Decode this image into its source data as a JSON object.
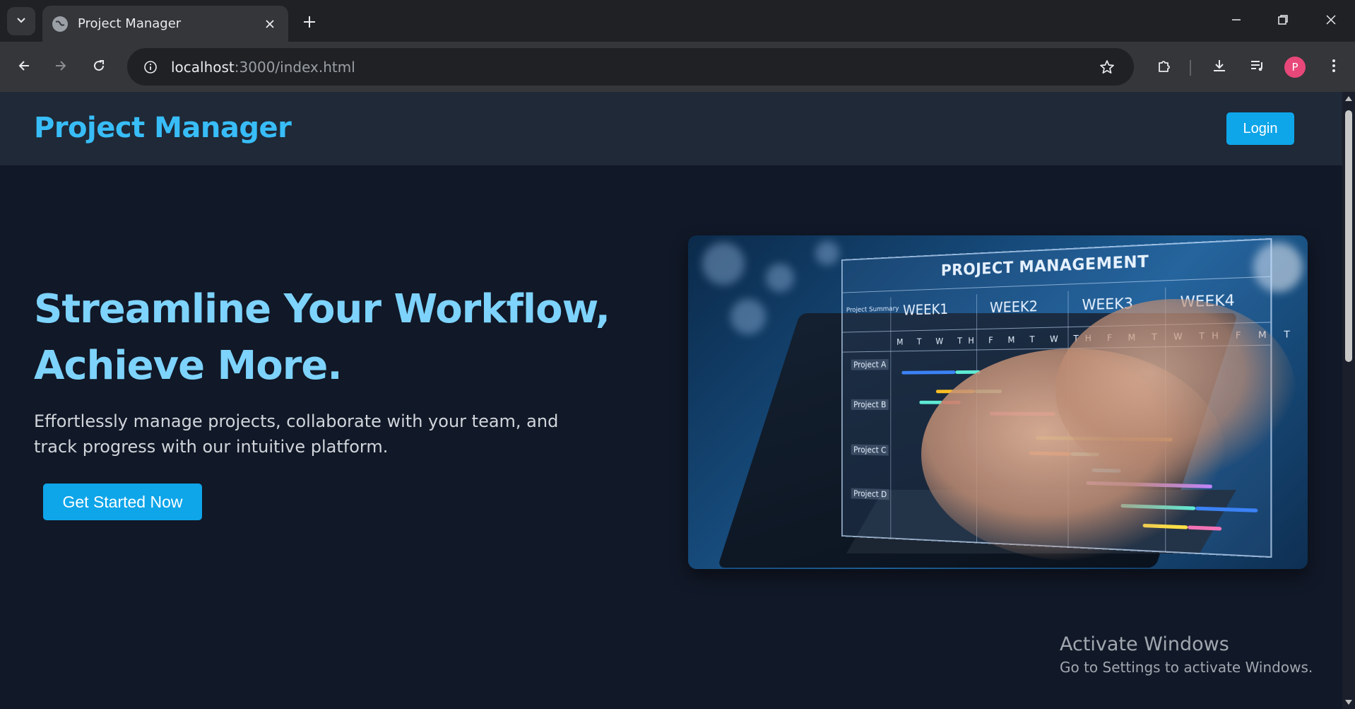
{
  "browser": {
    "tab_title": "Project Manager",
    "url_host": "localhost",
    "url_path": ":3000/index.html",
    "profile_initial": "P"
  },
  "site": {
    "brand": "Project Manager",
    "login_label": "Login"
  },
  "hero": {
    "title_line1": "Streamline Your Workflow,",
    "title_line2": "Achieve More.",
    "subtitle": "Effortlessly manage projects, collaborate with your team, and track progress with our intuitive platform.",
    "cta_label": "Get Started Now"
  },
  "hero_image": {
    "panel_title": "PROJECT MANAGEMENT",
    "summary_label": "Project Summary",
    "weeks": [
      "WEEK1",
      "WEEK2",
      "WEEK3",
      "WEEK4"
    ],
    "days": "M T W TH F M T W TH F M T W TH F M T W TH F",
    "projects": [
      "Project A",
      "Project B",
      "Project C",
      "Project D"
    ]
  },
  "watermark": {
    "title": "Activate Windows",
    "subtitle": "Go to Settings to activate Windows."
  },
  "colors": {
    "page_bg": "#111827",
    "header_bg": "#1f2937",
    "brand": "#38bdf8",
    "hero_title": "#7dd3fc",
    "button": "#0ea5e9"
  },
  "icons": [
    "tab-search-icon",
    "globe-icon",
    "close-icon",
    "plus-icon",
    "minimize-icon",
    "restore-icon",
    "back-arrow-icon",
    "forward-arrow-icon",
    "reload-icon",
    "site-info-icon",
    "star-icon",
    "extensions-icon",
    "download-icon",
    "media-controls-icon",
    "more-vert-icon"
  ]
}
